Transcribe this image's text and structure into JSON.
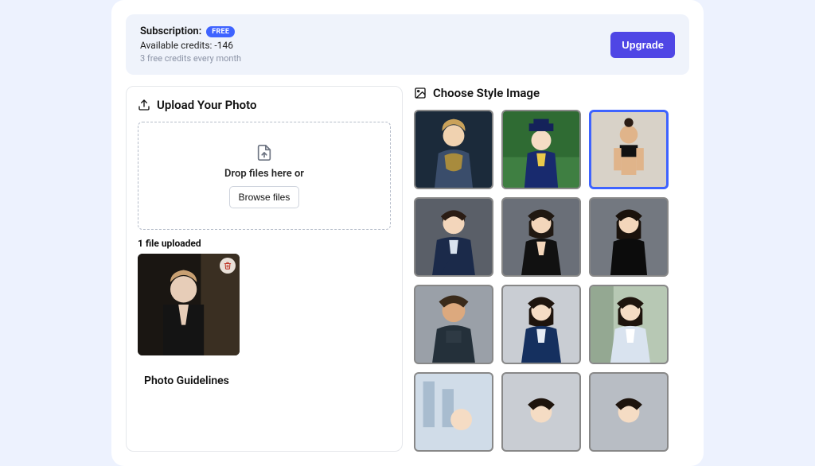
{
  "subscription": {
    "label": "Subscription:",
    "badge": "FREE",
    "credits": "Available credits: -146",
    "note": "3 free credits every month",
    "upgrade": "Upgrade"
  },
  "upload": {
    "title": "Upload Your Photo",
    "drop_text": "Drop files here or",
    "browse": "Browse files",
    "status": "1 file uploaded"
  },
  "guidelines": {
    "title": "Photo Guidelines"
  },
  "styles": {
    "title": "Choose Style Image",
    "selected_index": 2
  }
}
